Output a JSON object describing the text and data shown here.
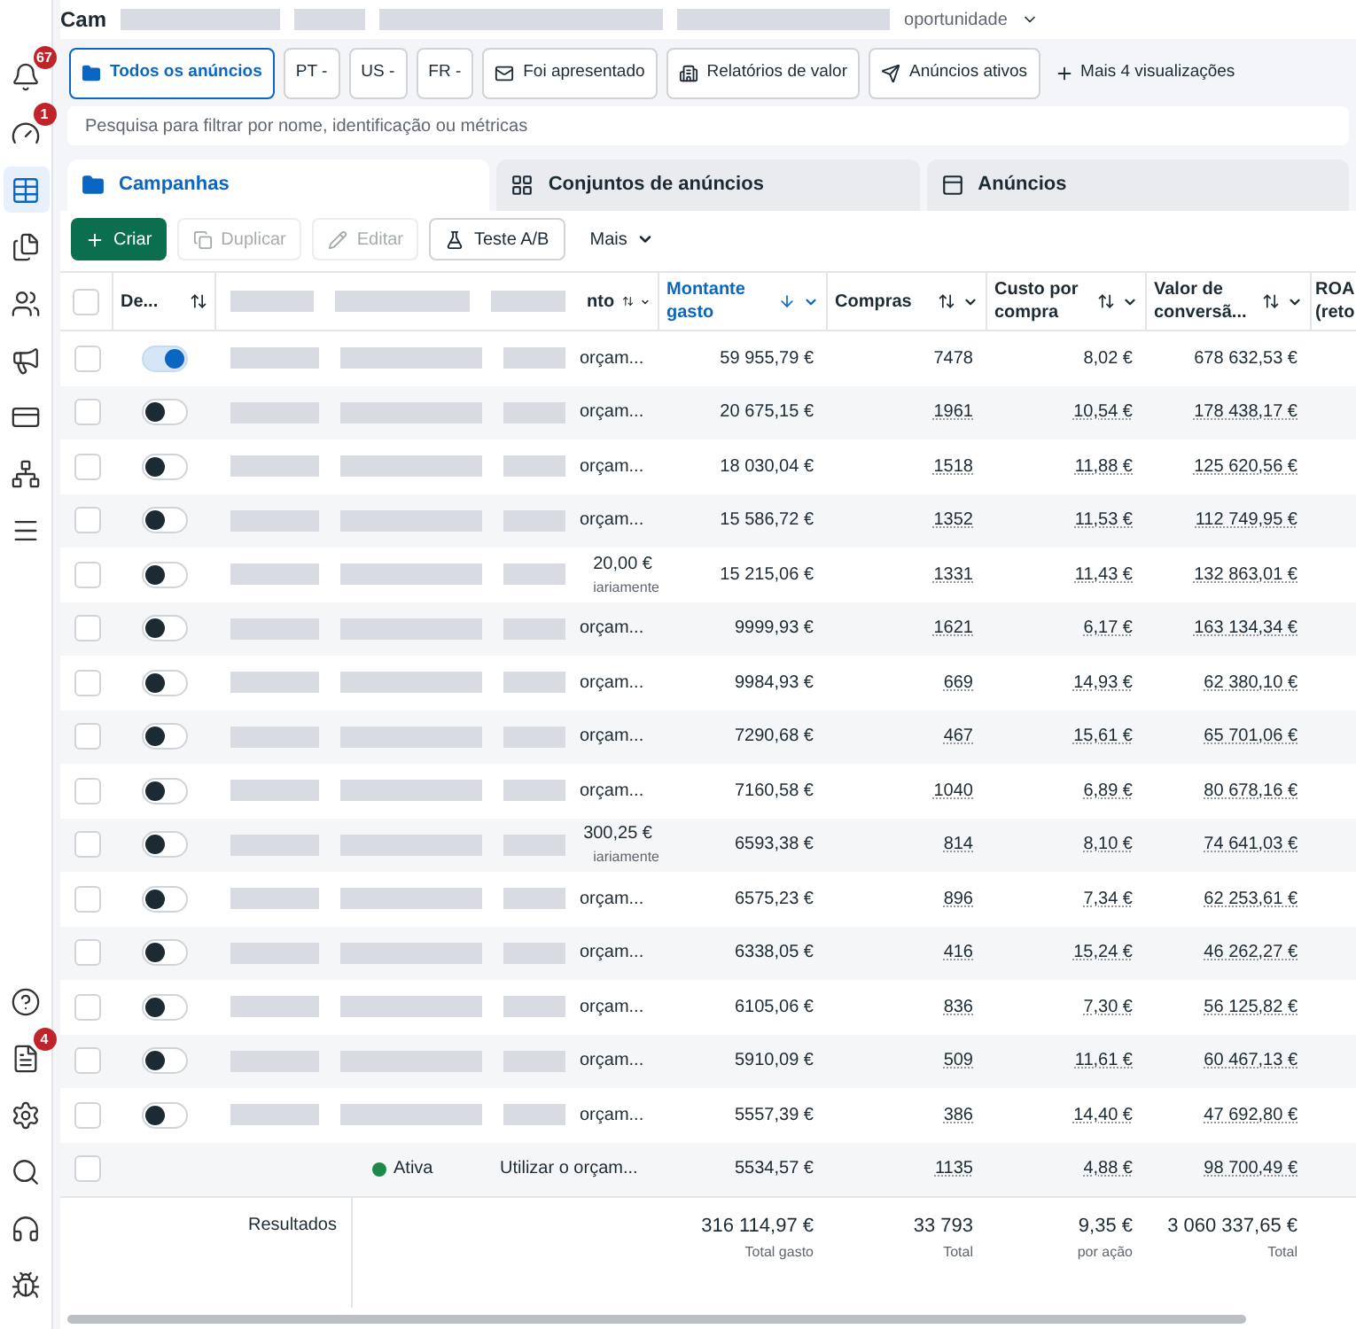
{
  "header": {
    "title": "Cam",
    "subtitle": "oportunidade"
  },
  "sidebar": {
    "top": [
      {
        "badge": "67",
        "selected": false
      },
      {
        "badge": "1",
        "selected": false
      },
      {
        "selected": true
      },
      {
        "selected": false
      },
      {
        "selected": false
      },
      {
        "selected": false
      },
      {
        "selected": false
      },
      {
        "selected": false
      },
      {
        "selected": false
      }
    ],
    "bottom": [
      {
        "selected": false
      },
      {
        "badge": "4",
        "selected": false
      },
      {
        "selected": false
      },
      {
        "selected": false
      },
      {
        "selected": false
      },
      {
        "selected": false
      }
    ]
  },
  "views": [
    {
      "label": "Todos os anúncios",
      "selected": true
    },
    {
      "label": "PT -",
      "selected": false
    },
    {
      "label": "US -",
      "selected": false
    },
    {
      "label": "FR -",
      "selected": false
    },
    {
      "label": "Foi apresentado",
      "selected": false
    },
    {
      "label": "Relatórios de valor",
      "selected": false
    },
    {
      "label": "Anúncios ativos",
      "selected": false
    }
  ],
  "more_views": "Mais 4 visualizações",
  "search": {
    "placeholder": "Pesquisa para filtrar por nome, identificação ou métricas"
  },
  "tabs": [
    {
      "label": "Campanhas",
      "selected": true
    },
    {
      "label": "Conjuntos de anúncios",
      "selected": false
    },
    {
      "label": "Anúncios",
      "selected": false
    }
  ],
  "toolbar": [
    {
      "label": "Criar",
      "kind": "primary",
      "disabled": false
    },
    {
      "label": "Duplicar",
      "kind": "duplicate",
      "disabled": true
    },
    {
      "label": "Editar",
      "kind": "edit",
      "disabled": true
    },
    {
      "label": "Teste A/B",
      "kind": "test",
      "disabled": false
    },
    {
      "label": "Mais",
      "kind": "menu",
      "disabled": false
    }
  ],
  "table": {
    "select_all": {
      "checked": false
    },
    "columns": [
      {
        "label": "De...",
        "sorted": false
      },
      {
        "label": "nto",
        "sorted": false
      },
      {
        "label": "Montante gasto",
        "sorted": true
      },
      {
        "label": "Compras",
        "sorted": false
      },
      {
        "label": "Custo por compra",
        "sorted": false
      },
      {
        "label": "Valor de conversã...",
        "sorted": false
      },
      {
        "label": "ROA (reto",
        "sorted": false
      }
    ],
    "rows": [
      {
        "checked": false,
        "on": true,
        "budget": "orçam...",
        "spent": "59 955,79 €",
        "purchases": "7478",
        "cost": "8,02 €",
        "value": "678 632,53 €"
      },
      {
        "checked": false,
        "on": false,
        "budget": "orçam...",
        "spent": "20 675,15 €",
        "purchases": "1961",
        "cost": "10,54 €",
        "value": "178 438,17 €"
      },
      {
        "checked": false,
        "on": false,
        "budget": "orçam...",
        "spent": "18 030,04 €",
        "purchases": "1518",
        "cost": "11,88 €",
        "value": "125 620,56 €"
      },
      {
        "checked": false,
        "on": false,
        "budget": "orçam...",
        "spent": "15 586,72 €",
        "purchases": "1352",
        "cost": "11,53 €",
        "value": "112 749,95 €"
      },
      {
        "checked": false,
        "on": false,
        "budget": "20,00 €",
        "budget_note": "iariamente",
        "spent": "15 215,06 €",
        "purchases": "1331",
        "cost": "11,43 €",
        "value": "132 863,01 €"
      },
      {
        "checked": false,
        "on": false,
        "budget": "orçam...",
        "spent": "9999,93 €",
        "purchases": "1621",
        "cost": "6,17 €",
        "value": "163 134,34 €"
      },
      {
        "checked": false,
        "on": false,
        "budget": "orçam...",
        "spent": "9984,93 €",
        "purchases": "669",
        "cost": "14,93 €",
        "value": "62 380,10 €"
      },
      {
        "checked": false,
        "on": false,
        "budget": "orçam...",
        "spent": "7290,68 €",
        "purchases": "467",
        "cost": "15,61 €",
        "value": "65 701,06 €"
      },
      {
        "checked": false,
        "on": false,
        "budget": "orçam...",
        "spent": "7160,58 €",
        "purchases": "1040",
        "cost": "6,89 €",
        "value": "80 678,16 €"
      },
      {
        "checked": false,
        "on": false,
        "budget": "300,25 €",
        "budget_note": "iariamente",
        "spent": "6593,38 €",
        "purchases": "814",
        "cost": "8,10 €",
        "value": "74 641,03 €"
      },
      {
        "checked": false,
        "on": false,
        "budget": "orçam...",
        "spent": "6575,23 €",
        "purchases": "896",
        "cost": "7,34 €",
        "value": "62 253,61 €"
      },
      {
        "checked": false,
        "on": false,
        "budget": "orçam...",
        "spent": "6338,05 €",
        "purchases": "416",
        "cost": "15,24 €",
        "value": "46 262,27 €"
      },
      {
        "checked": false,
        "on": false,
        "budget": "orçam...",
        "spent": "6105,06 €",
        "purchases": "836",
        "cost": "7,30 €",
        "value": "56 125,82 €"
      },
      {
        "checked": false,
        "on": false,
        "budget": "orçam...",
        "spent": "5910,09 €",
        "purchases": "509",
        "cost": "11,61 €",
        "value": "60 467,13 €"
      },
      {
        "checked": false,
        "on": false,
        "budget": "orçam...",
        "spent": "5557,39 €",
        "purchases": "386",
        "cost": "14,40 €",
        "value": "47 692,80 €"
      },
      {
        "checked": false,
        "status": "Ativa",
        "budget": "Utilizar o orçam...",
        "spent": "5534,57 €",
        "purchases": "1135",
        "cost": "4,88 €",
        "value": "98 700,49 €"
      }
    ],
    "footer": {
      "label": "Resultados",
      "cells": [
        {
          "value": "316 114,97 €",
          "note": "Total gasto"
        },
        {
          "value": "33 793",
          "note": "Total"
        },
        {
          "value": "9,35 €",
          "note": "por ação"
        },
        {
          "value": "3 060 337,65 €",
          "note": "Total"
        }
      ]
    }
  }
}
